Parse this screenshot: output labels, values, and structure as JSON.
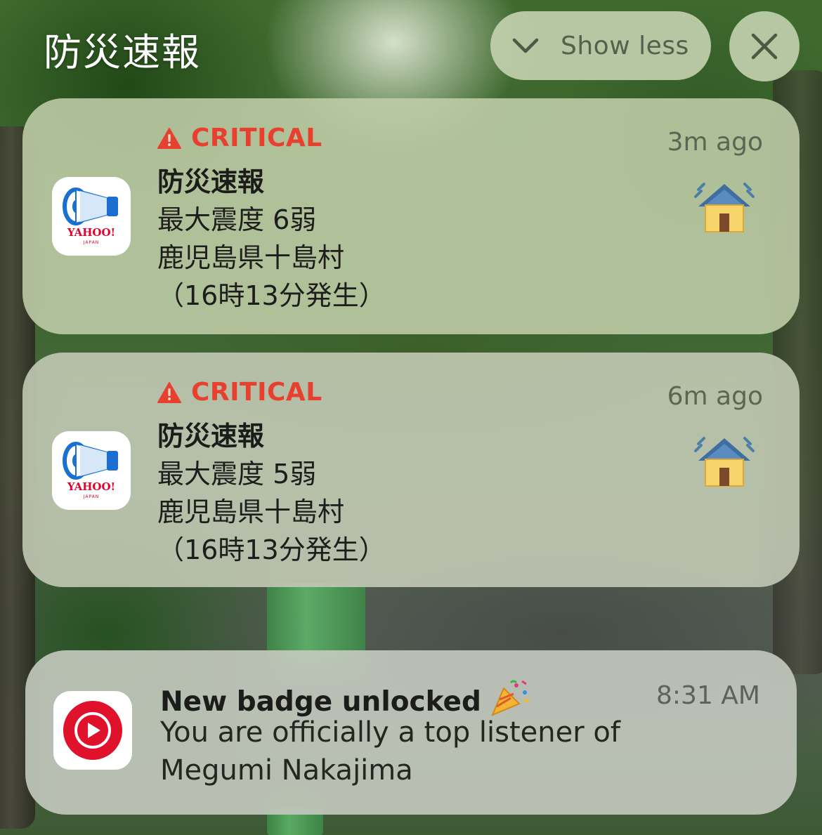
{
  "header": {
    "app_title": "防災速報",
    "show_less_label": "Show less",
    "close_icon": "close-icon",
    "chevron_icon": "chevron-down-icon"
  },
  "notifications": [
    {
      "app": "防災速報",
      "app_icon": "megaphone-icon",
      "icon_text": "YAHOO!",
      "icon_subtext": "JAPAN",
      "badge": "CRITICAL",
      "badge_icon": "warning-icon",
      "badge_color": "#e8402f",
      "time": "3m ago",
      "title": "防災速報",
      "lines": [
        "最大震度 6弱",
        "鹿児島県十島村",
        "（16時13分発生）"
      ],
      "attachment_icon": "earthquake-house-icon"
    },
    {
      "app": "防災速報",
      "app_icon": "megaphone-icon",
      "icon_text": "YAHOO!",
      "icon_subtext": "JAPAN",
      "badge": "CRITICAL",
      "badge_icon": "warning-icon",
      "badge_color": "#e8402f",
      "time": "6m ago",
      "title": "防災速報",
      "lines": [
        "最大震度 5弱",
        "鹿児島県十島村",
        "（16時13分発生）"
      ],
      "attachment_icon": "earthquake-house-icon"
    },
    {
      "app": "YouTube Music",
      "app_icon": "play-icon",
      "time": "8:31 AM",
      "title": "New badge unlocked",
      "title_emoji_icon": "party-popper-icon",
      "lines": [
        "You are officially a top listener of",
        "Megumi Nakajima"
      ],
      "accent_color": "#e0112a"
    }
  ]
}
